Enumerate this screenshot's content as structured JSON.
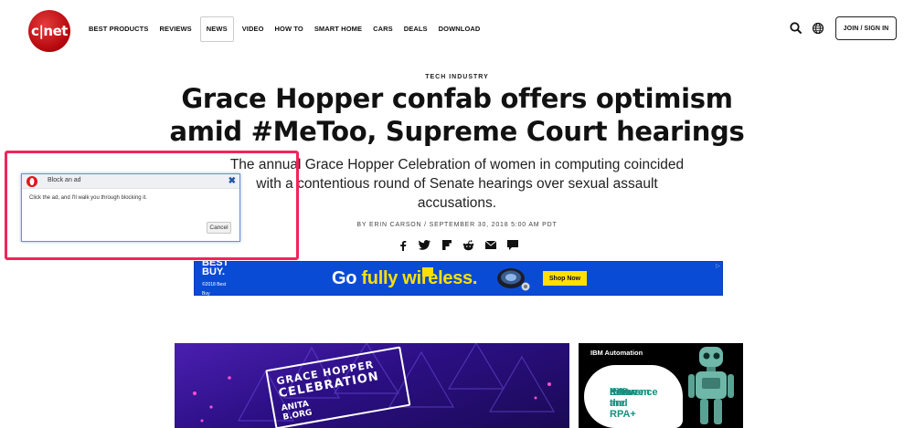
{
  "header": {
    "logo_text": "c|net",
    "nav": [
      "BEST PRODUCTS",
      "REVIEWS",
      "NEWS",
      "VIDEO",
      "HOW TO",
      "SMART HOME",
      "CARS",
      "DEALS",
      "DOWNLOAD"
    ],
    "active_nav": "NEWS",
    "search_icon": "search-icon",
    "globe_icon": "globe-icon",
    "join_label": "JOIN / SIGN IN"
  },
  "article": {
    "kicker": "TECH INDUSTRY",
    "headline_line1": "Grace Hopper confab offers optimism",
    "headline_line2": "amid #MeToo, Supreme Court hearings",
    "dek": "The annual Grace Hopper Celebration of women in computing coincided with a contentious round of Senate hearings over sexual assault accusations.",
    "byline": "BY ERIN CARSON  /  SEPTEMBER 30, 2018 5:00 AM PDT",
    "share_icons": [
      "facebook-icon",
      "twitter-icon",
      "flipboard-icon",
      "reddit-icon",
      "email-icon",
      "comment-icon"
    ]
  },
  "ad_banner": {
    "brand_line1": "BEST",
    "brand_line2": "BUY.",
    "copyright": "©2018 Best Buy",
    "text_part1": "Go ",
    "text_part2": "fully wireless.",
    "button": "Shop Now",
    "ad_choice": "▷",
    "colors": {
      "background": "#0a4bd6",
      "accent": "#ffe000"
    }
  },
  "hero_image": {
    "sign_line1": "GRACE HOPPER",
    "sign_line2": "CELEBRATION",
    "sign_line3": "ANITA",
    "sign_line4": "B.ORG"
  },
  "sidebar_ad": {
    "brand": "IBM Automation",
    "bubble_line1": "Know the",
    "bubble_line2": "difference",
    "bubble_line3": "between",
    "bubble_line4": "RPA and RPA+"
  },
  "blocker_dialog": {
    "title": "Block an ad",
    "message": "Click the ad, and I'll walk you through blocking it.",
    "cancel_label": "Cancel",
    "close_icon": "close-icon",
    "icon": "opera-icon",
    "highlight_color": "#f1245b"
  }
}
